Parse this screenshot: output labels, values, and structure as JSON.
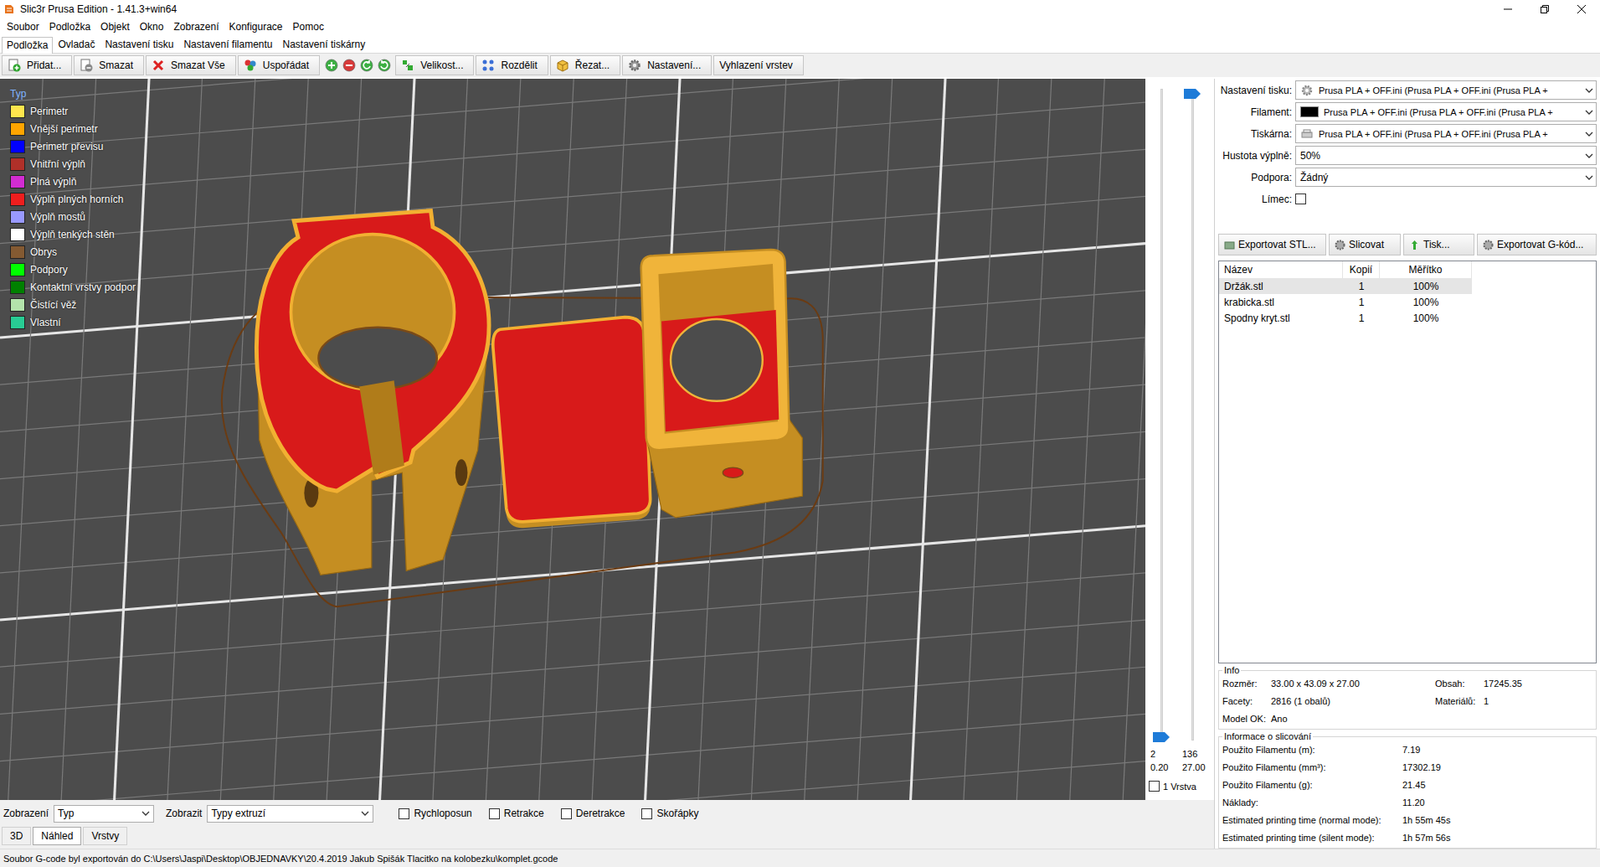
{
  "window": {
    "title": "Slic3r Prusa Edition - 1.41.3+win64"
  },
  "menu": [
    "Soubor",
    "Podložka",
    "Objekt",
    "Okno",
    "Zobrazení",
    "Konfigurace",
    "Pomoc"
  ],
  "tabs": [
    {
      "label": "Podložka",
      "selected": true
    },
    {
      "label": "Ovladač",
      "selected": false
    },
    {
      "label": "Nastavení tisku",
      "selected": false
    },
    {
      "label": "Nastavení filamentu",
      "selected": false
    },
    {
      "label": "Nastavení tiskárny",
      "selected": false
    }
  ],
  "toolbar": [
    {
      "label": "Přidat..."
    },
    {
      "label": "Smazat"
    },
    {
      "label": "Smazat Vše"
    },
    {
      "label": "Uspořádat"
    },
    {
      "label": "Velikost..."
    },
    {
      "label": "Rozdělit"
    },
    {
      "label": "Řezat..."
    },
    {
      "label": "Nastavení..."
    },
    {
      "label": "Vyhlazení vrstev"
    }
  ],
  "legend": {
    "title": "Typ",
    "items": [
      {
        "label": "Perimetr",
        "color": "#FFE64D"
      },
      {
        "label": "Vnější perimetr",
        "color": "#FFA500"
      },
      {
        "label": "Perimetr převisu",
        "color": "#0000FF"
      },
      {
        "label": "Vnitřní výplň",
        "color": "#B03029"
      },
      {
        "label": "Plná výplň",
        "color": "#D22CD2"
      },
      {
        "label": "Výplň plných horních",
        "color": "#F01E1E"
      },
      {
        "label": "Výplň mostů",
        "color": "#9999FF"
      },
      {
        "label": "Výplň tenkých stěn",
        "color": "#FFFFFF"
      },
      {
        "label": "Obrys",
        "color": "#845A32"
      },
      {
        "label": "Podpory",
        "color": "#00FF00"
      },
      {
        "label": "Kontaktní vrstvy podpor",
        "color": "#008000"
      },
      {
        "label": "Čistící věž",
        "color": "#B3E3AB"
      },
      {
        "label": "Vlastní",
        "color": "#28CC94"
      }
    ]
  },
  "layer_slider": {
    "lower": {
      "layer": "2",
      "height": "0.20",
      "level": 0
    },
    "upper": {
      "layer": "136",
      "height": "27.00",
      "level": 1
    },
    "single_layer": {
      "label": "1 Vrstva",
      "checked": false
    }
  },
  "preview_controls": {
    "view_label": "Zobrazení",
    "view_value": "Typ",
    "show_label": "Zobrazit",
    "show_value": "Typy extruzí",
    "options": [
      {
        "label": "Rychloposun",
        "checked": false
      },
      {
        "label": "Retrakce",
        "checked": false
      },
      {
        "label": "Deretrakce",
        "checked": false
      },
      {
        "label": "Skořápky",
        "checked": false
      }
    ]
  },
  "view_tabs": [
    {
      "label": "3D",
      "selected": false
    },
    {
      "label": "Náhled",
      "selected": true
    },
    {
      "label": "Vrstvy",
      "selected": false
    }
  ],
  "settings": [
    {
      "label": "Nastavení tisku:",
      "kind": "print",
      "value": "Prusa PLA + OFF.ini (Prusa PLA + OFF.ini (Prusa PLA +"
    },
    {
      "label": "Filament:",
      "kind": "filament",
      "value": "Prusa PLA + OFF.ini (Prusa PLA + OFF.ini (Prusa PLA +",
      "color": "#000000"
    },
    {
      "label": "Tiskárna:",
      "kind": "printer",
      "value": "Prusa PLA + OFF.ini (Prusa PLA + OFF.ini (Prusa PLA +"
    },
    {
      "label": "Hustota výplně:",
      "kind": "combo",
      "value": "50%"
    },
    {
      "label": "Podpora:",
      "kind": "combo",
      "value": "Žádný"
    },
    {
      "label": "Límec:",
      "kind": "checkbox",
      "checked": false
    }
  ],
  "actions": [
    {
      "label": "Exportovat STL..."
    },
    {
      "label": "Slicovat"
    },
    {
      "label": "Tisk..."
    },
    {
      "label": "Exportovat G-kód..."
    }
  ],
  "objects": {
    "columns": [
      "Název",
      "Kopií",
      "Měřítko"
    ],
    "rows": [
      {
        "name": "Držák.stl",
        "copies": "1",
        "scale": "100%",
        "selected": true
      },
      {
        "name": "krabicka.stl",
        "copies": "1",
        "scale": "100%",
        "selected": false
      },
      {
        "name": "Spodny kryt.stl",
        "copies": "1",
        "scale": "100%",
        "selected": false
      }
    ]
  },
  "info": {
    "title": "Info",
    "fields": [
      {
        "label": "Rozměr:",
        "value": "33.00 x 43.09 x 27.00"
      },
      {
        "label": "Obsah:",
        "value": "17245.35"
      },
      {
        "label": "Facety:",
        "value": "2816 (1 obalů)"
      },
      {
        "label": "Materiálů:",
        "value": "1"
      },
      {
        "label": "Model OK:",
        "value": "Ano"
      }
    ]
  },
  "slice_info": {
    "title": "Informace o slicování",
    "fields": [
      {
        "label": "Použito Filamentu (m):",
        "value": "7.19"
      },
      {
        "label": "Použito Filamentu (mm³):",
        "value": "17302.19"
      },
      {
        "label": "Použito Filamentu (g):",
        "value": "21.45"
      },
      {
        "label": "Náklady:",
        "value": "11.20"
      },
      {
        "label": "Estimated printing time (normal mode):",
        "value": "1h 55m 45s"
      },
      {
        "label": "Estimated printing time (silent mode):",
        "value": "1h 57m 56s"
      }
    ]
  },
  "status_bar": "Soubor G-code byl exportován do C:\\Users\\Jaspi\\Desktop\\OBJEDNAVKY\\20.4.2019 Jakub Spišák Tlacitko na kolobezku\\komplet.gcode"
}
